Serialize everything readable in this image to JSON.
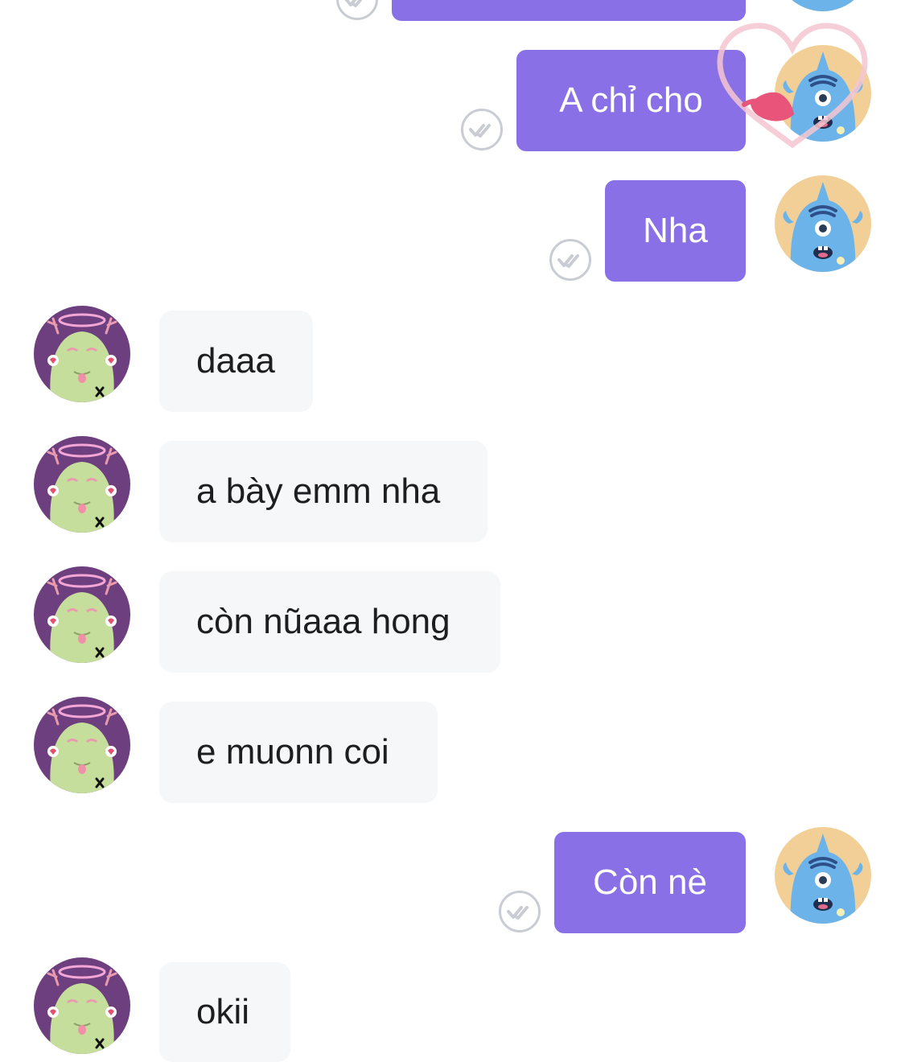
{
  "conversation": {
    "messages": [
      {
        "id": "m0",
        "direction": "outgoing",
        "text": ""
      },
      {
        "id": "m1",
        "direction": "outgoing",
        "text": "A chỉ cho"
      },
      {
        "id": "m2",
        "direction": "outgoing",
        "text": "Nha"
      },
      {
        "id": "m3",
        "direction": "incoming",
        "text": "daaa"
      },
      {
        "id": "m4",
        "direction": "incoming",
        "text": "a bày emm nha"
      },
      {
        "id": "m5",
        "direction": "incoming",
        "text": "còn nũaaa hong"
      },
      {
        "id": "m6",
        "direction": "incoming",
        "text": "e muonn coi"
      },
      {
        "id": "m7",
        "direction": "outgoing",
        "text": "Còn nè"
      },
      {
        "id": "m8",
        "direction": "incoming",
        "text": "okii"
      }
    ]
  },
  "icons": {
    "sender_avatar": "blue-monster-avatar-icon",
    "receiver_avatar": "green-monster-avatar-icon",
    "read_receipt": "double-check-icon",
    "reaction": "heart-reaction-icon"
  },
  "colors": {
    "outgoing_bubble": "#8A70E6",
    "incoming_bubble": "#F6F7F9",
    "outgoing_text": "#FFFFFF",
    "incoming_text": "#1C1E21",
    "read_receipt": "#C9CDD3"
  }
}
